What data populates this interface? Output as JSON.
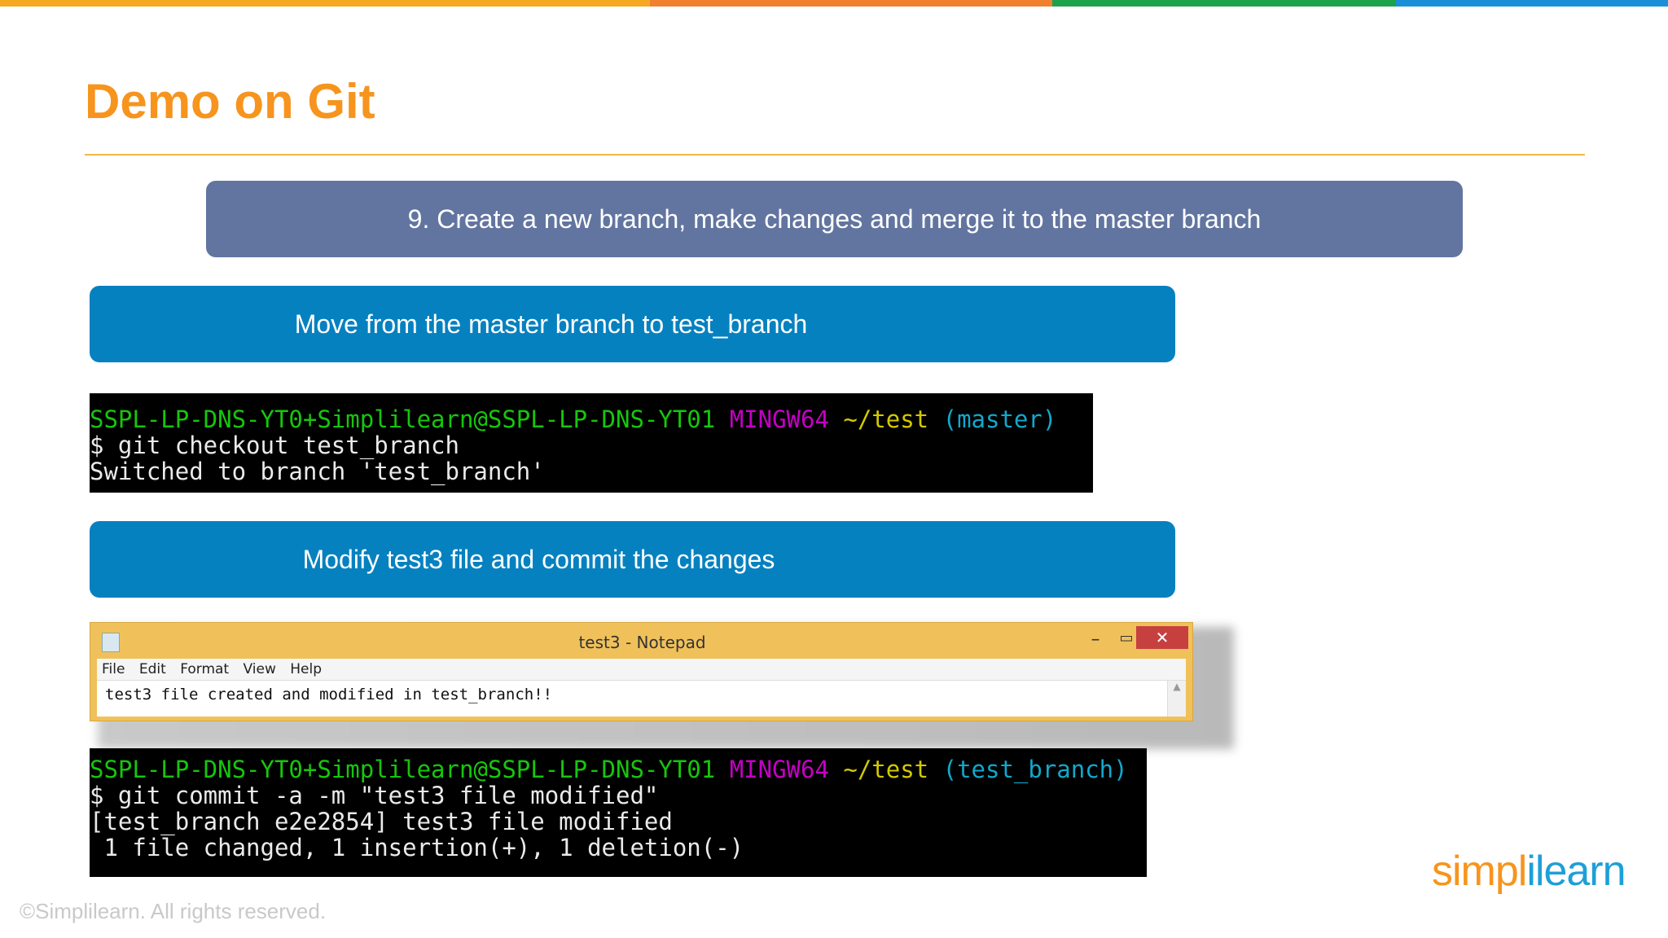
{
  "colors": {
    "topbar": [
      "#F7A823",
      "#F07F2E",
      "#1BA24B",
      "#1A8FD7"
    ],
    "accent": "#F7941D",
    "step_box": "#6275A0",
    "sub_box": "#0681C0"
  },
  "slide": {
    "title": "Demo on Git",
    "step": "9. Create a new branch, make changes and merge it to the master branch",
    "substep1": "Move from the master branch to test_branch",
    "substep2": "Modify test3 file and commit the changes"
  },
  "terminal1": {
    "prompt_user": "SSPL-LP-DNS-YT0+Simplilearn@SSPL-LP-DNS-YT01",
    "prompt_env": "MINGW64",
    "prompt_path": "~/test",
    "prompt_branch": "(master)",
    "lines": [
      "$ git checkout test_branch",
      "Switched to branch 'test_branch'"
    ]
  },
  "notepad": {
    "title": "test3 - Notepad",
    "menu": [
      "File",
      "Edit",
      "Format",
      "View",
      "Help"
    ],
    "content": "test3 file created and modified in test_branch!!",
    "icon": "notepad-icon"
  },
  "terminal2": {
    "prompt_user": "SSPL-LP-DNS-YT0+Simplilearn@SSPL-LP-DNS-YT01",
    "prompt_env": "MINGW64",
    "prompt_path": "~/test",
    "prompt_branch": "(test_branch)",
    "lines": [
      "$ git commit -a -m \"test3 file modified\"",
      "[test_branch e2e2854] test3 file modified",
      " 1 file changed, 1 insertion(+), 1 deletion(-)"
    ]
  },
  "footer": {
    "copyright": "©Simplilearn. All rights reserved.",
    "logo_a": "simpl",
    "logo_b": "i",
    "logo_c": "learn"
  }
}
